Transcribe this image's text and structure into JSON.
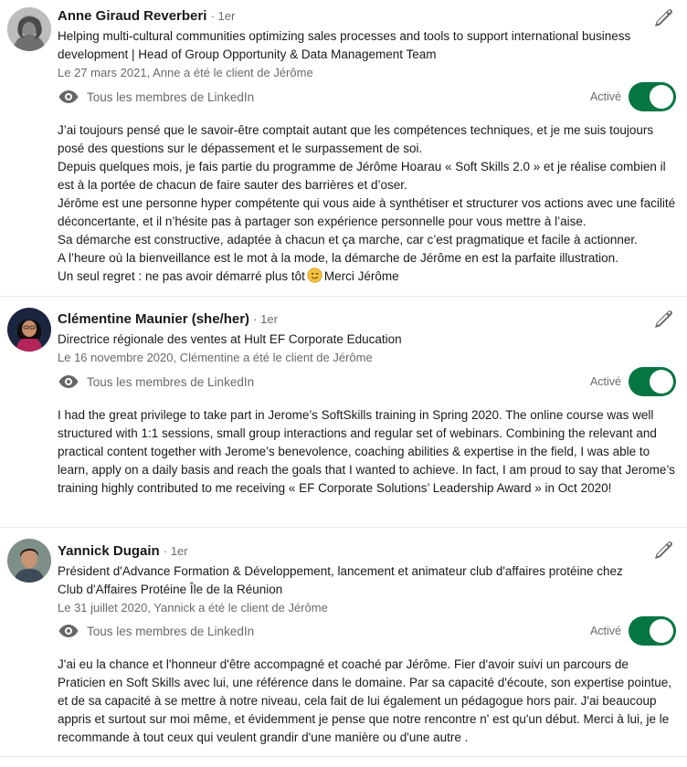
{
  "colors": {
    "toggle_on": "#057642",
    "icon_gray": "#666666",
    "text_secondary": "#666666"
  },
  "recommendations": [
    {
      "name": "Anne Giraud Reverberi",
      "degree": "· 1er",
      "headline": "Helping multi-cultural communities optimizing sales processes and tools to support international business development | Head of Group Opportunity & Data Management Team",
      "date": "Le 27 mars 2021, Anne a été le client de Jérôme",
      "visibility": "Tous les membres de LinkedIn",
      "toggle_label": "Activé",
      "toggle_on": true,
      "paragraphs": [
        "J’ai toujours pensé que le savoir-être comptait autant que les compétences techniques, et je me suis toujours posé des questions sur le dépassement et le surpassement de soi.",
        "Depuis quelques mois, je fais partie du programme de Jérôme Hoarau « Soft Skills 2.0 » et je réalise combien il est à la portée de chacun de faire sauter des barrières et d’oser.",
        "Jérôme est une personne hyper compétente qui vous aide à synthétiser et structurer vos actions avec une facilité déconcertante, et il n’hésite pas à partager son expérience personnelle pour vous mettre à l’aise.",
        "Sa démarche est constructive, adaptée à chacun et ça marche, car c’est pragmatique et facile à actionner.",
        "A l’heure où la bienveillance est le mot à la mode, la démarche de Jérôme en est la parfaite illustration."
      ],
      "last_line_before": "Un seul regret : ne pas avoir démarré plus tôt",
      "last_line_emoji": "wink-emoji",
      "last_line_after": "Merci Jérôme"
    },
    {
      "name": "Clémentine Maunier (she/her)",
      "degree": "· 1er",
      "headline": "Directrice régionale des ventes at Hult EF Corporate Education",
      "date": "Le 16 novembre 2020, Clémentine a été le client de Jérôme",
      "visibility": "Tous les membres de LinkedIn",
      "toggle_label": "Activé",
      "toggle_on": true,
      "paragraphs": [
        "I had the great privilege to take part in Jerome’s SoftSkills training in Spring 2020. The online course was well structured with 1:1 sessions, small group interactions and regular set of webinars. Combining the relevant and practical content together with Jerome’s benevolence, coaching abilities & expertise in the field, I was able to learn, apply on a daily basis and reach the goals that I wanted to achieve. In fact, I am proud to say that Jerome’s training highly contributed to me receiving « EF Corporate Solutions’ Leadership Award » in Oct 2020!"
      ]
    },
    {
      "name": "Yannick Dugain",
      "degree": "· 1er",
      "headline": "Président d'Advance Formation & Développement, lancement et animateur club d'affaires protéine chez Club d'Affaires Protéine Île de la Réunion",
      "date": "Le 31 juillet 2020, Yannick a été le client de Jérôme",
      "visibility": "Tous les membres de LinkedIn",
      "toggle_label": "Activé",
      "toggle_on": true,
      "paragraphs": [
        "J'ai eu la chance et l'honneur d'être accompagné et coaché par Jérôme. Fier d'avoir suivi un parcours de Praticien en Soft Skills avec lui, une référence dans le domaine. Par sa capacité d'écoute, son expertise pointue, et de sa capacité à se mettre à notre niveau, cela fait de lui également un pédagogue hors pair. J'ai beaucoup appris et surtout sur moi même, et évidemment je pense que notre rencontre n' est qu'un début. Merci à lui, je le recommande à tout ceux qui veulent grandir d'une manière ou d'une autre ."
      ]
    }
  ]
}
